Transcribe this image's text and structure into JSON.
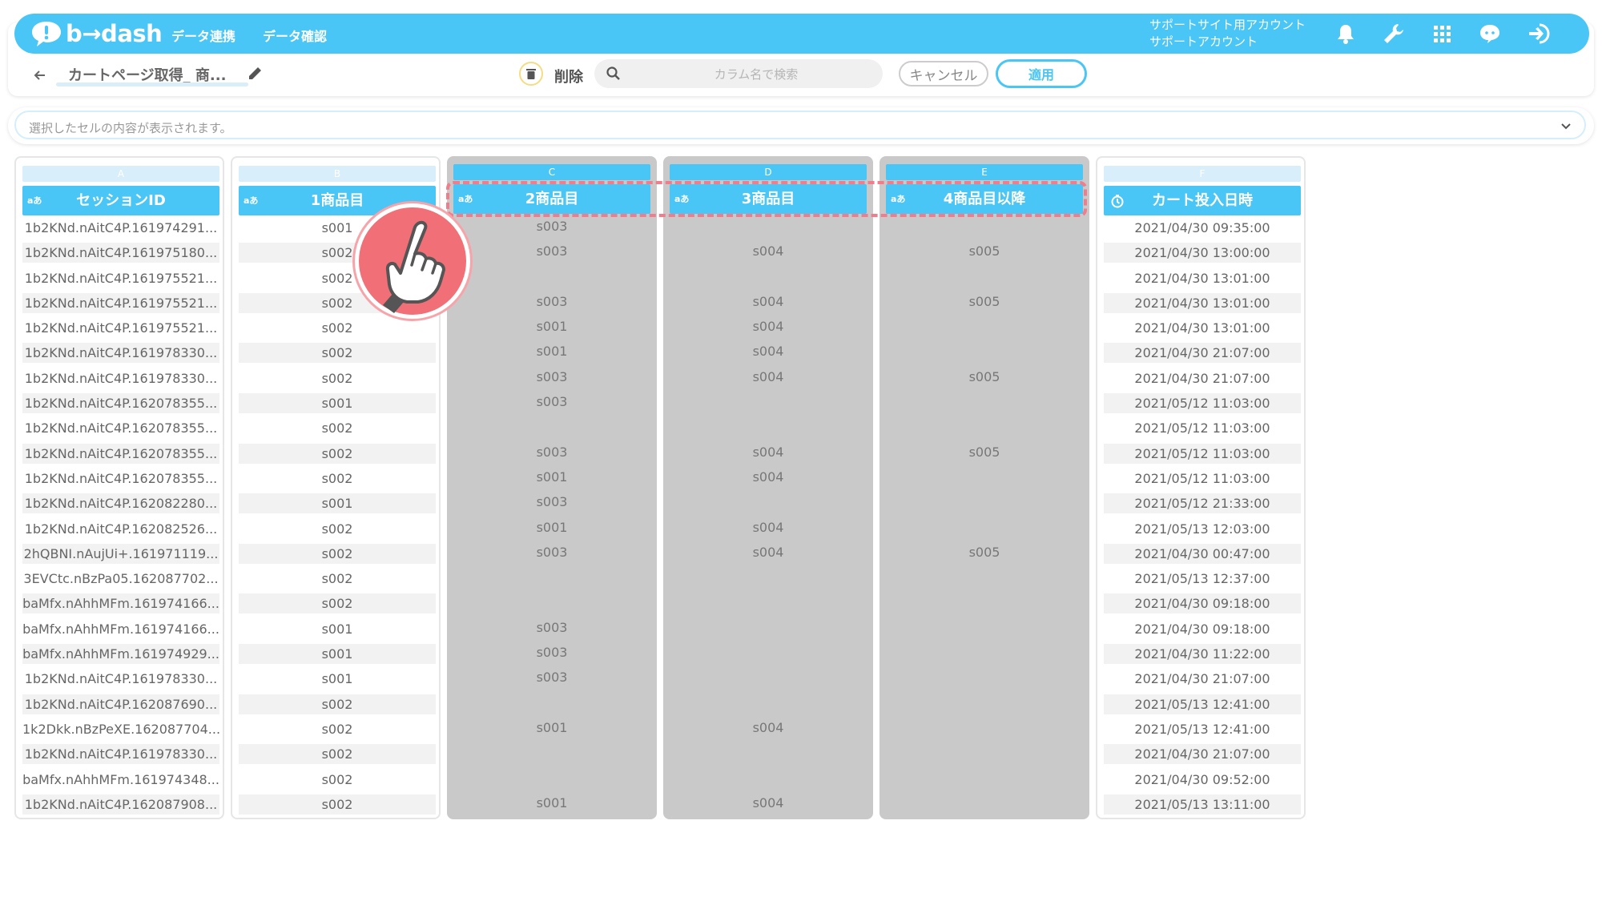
{
  "nav": {
    "logo_text": "b→dash",
    "links": [
      "データ連携",
      "データ確認"
    ],
    "account_line1": "サポートサイト用アカウント",
    "account_line2": "サポートアカウント",
    "icons": [
      "bell-icon",
      "wrench-icon",
      "grid-icon",
      "support-chat-icon",
      "logout-icon"
    ],
    "color": "#49c5f6"
  },
  "toolbar": {
    "title": "カートページ取得_ 商...",
    "delete_label": "削除",
    "search_placeholder": "カラム名で検索",
    "cancel_label": "キャンセル",
    "apply_label": "適用"
  },
  "cell_viewer": {
    "placeholder": "選択したセルの内容が表示されます。"
  },
  "columns": [
    {
      "letter": "A",
      "name": "セッションID",
      "type": "aあ",
      "selected": false,
      "cells": [
        "1b2KNd.nAitC4P.161974291...",
        "1b2KNd.nAitC4P.161975180...",
        "1b2KNd.nAitC4P.161975521...",
        "1b2KNd.nAitC4P.161975521...",
        "1b2KNd.nAitC4P.161975521...",
        "1b2KNd.nAitC4P.161978330...",
        "1b2KNd.nAitC4P.161978330...",
        "1b2KNd.nAitC4P.162078355...",
        "1b2KNd.nAitC4P.162078355...",
        "1b2KNd.nAitC4P.162078355...",
        "1b2KNd.nAitC4P.162078355...",
        "1b2KNd.nAitC4P.162082280...",
        "1b2KNd.nAitC4P.162082526...",
        "2hQBNI.nAujUi+.161971119...",
        "3EVCtc.nBzPa05.162087702...",
        "baMfx.nAhhMFm.161974166...",
        "baMfx.nAhhMFm.161974166...",
        "baMfx.nAhhMFm.161974929...",
        "1b2KNd.nAitC4P.161978330...",
        "1b2KNd.nAitC4P.162087690...",
        "1k2Dkk.nBzPeXE.162087704...",
        "1b2KNd.nAitC4P.161978330...",
        "baMfx.nAhhMFm.161974348...",
        "1b2KNd.nAitC4P.162087908..."
      ]
    },
    {
      "letter": "B",
      "name": "1商品目",
      "type": "aあ",
      "selected": false,
      "cells": [
        "s001",
        "s002",
        "s002",
        "s002",
        "s002",
        "s002",
        "s002",
        "s001",
        "s002",
        "s002",
        "s002",
        "s001",
        "s002",
        "s002",
        "s002",
        "s002",
        "s001",
        "s001",
        "s001",
        "s002",
        "s002",
        "s002",
        "s002",
        "s002"
      ]
    },
    {
      "letter": "C",
      "name": "2商品目",
      "type": "aあ",
      "selected": true,
      "cells": [
        "s003",
        "s003",
        "",
        "s003",
        "s001",
        "s001",
        "s003",
        "s003",
        "",
        "s003",
        "s001",
        "s003",
        "s001",
        "s003",
        "",
        "",
        "s003",
        "s003",
        "s003",
        "",
        "s001",
        "",
        "",
        "s001"
      ]
    },
    {
      "letter": "D",
      "name": "3商品目",
      "type": "aあ",
      "selected": true,
      "cells": [
        "",
        "s004",
        "",
        "s004",
        "s004",
        "s004",
        "s004",
        "",
        "",
        "s004",
        "s004",
        "",
        "s004",
        "s004",
        "",
        "",
        "",
        "",
        "",
        "",
        "s004",
        "",
        "",
        "s004"
      ]
    },
    {
      "letter": "E",
      "name": "4商品目以降",
      "type": "aあ",
      "selected": true,
      "cells": [
        "",
        "s005",
        "",
        "s005",
        "",
        "",
        "s005",
        "",
        "",
        "s005",
        "",
        "",
        "",
        "s005",
        "",
        "",
        "",
        "",
        "",
        "",
        "",
        "",
        "",
        ""
      ]
    },
    {
      "letter": "F",
      "name": "カート投入日時",
      "type": "clock",
      "selected": false,
      "cells": [
        "2021/04/30 09:35:00",
        "2021/04/30 13:00:00",
        "2021/04/30 13:01:00",
        "2021/04/30 13:01:00",
        "2021/04/30 13:01:00",
        "2021/04/30 21:07:00",
        "2021/04/30 21:07:00",
        "2021/05/12 11:03:00",
        "2021/05/12 11:03:00",
        "2021/05/12 11:03:00",
        "2021/05/12 11:03:00",
        "2021/05/12 21:33:00",
        "2021/05/13 12:03:00",
        "2021/04/30 00:47:00",
        "2021/05/13 12:37:00",
        "2021/04/30 09:18:00",
        "2021/04/30 09:18:00",
        "2021/04/30 11:22:00",
        "2021/04/30 21:07:00",
        "2021/05/13 12:41:00",
        "2021/05/13 12:41:00",
        "2021/04/30 21:07:00",
        "2021/04/30 09:52:00",
        "2021/05/13 13:11:00"
      ]
    }
  ]
}
